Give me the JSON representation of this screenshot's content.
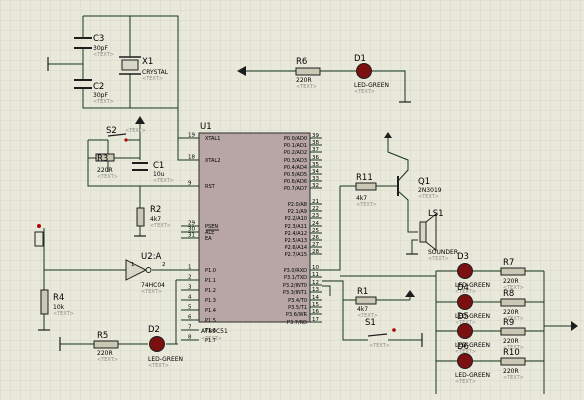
{
  "placeholder": "<TEXT>",
  "colors": {
    "background": "#e9e9db",
    "grid": "#c9c9b9",
    "wire": "#15351d",
    "ic_body": "#b8a6a6",
    "resistor": "#c8c8b4",
    "led": "#7a1010",
    "accent": "#b00000"
  },
  "u1": {
    "ref": "U1",
    "value": "AT89C51",
    "left_pins": [
      {
        "num": "19",
        "name": "XTAL1"
      },
      {
        "num": "18",
        "name": "XTAL2"
      },
      {
        "num": "9",
        "name": "RST"
      },
      {
        "num": "29",
        "name": "PSEN"
      },
      {
        "num": "30",
        "name": "ALE"
      },
      {
        "num": "31",
        "name": "EA"
      },
      {
        "num": "1",
        "name": "P1.0"
      },
      {
        "num": "2",
        "name": "P1.1"
      },
      {
        "num": "3",
        "name": "P1.2"
      },
      {
        "num": "4",
        "name": "P1.3"
      },
      {
        "num": "5",
        "name": "P1.4"
      },
      {
        "num": "6",
        "name": "P1.5"
      },
      {
        "num": "7",
        "name": "P1.6"
      },
      {
        "num": "8",
        "name": "P1.7"
      }
    ],
    "right_pins": [
      {
        "num": "39",
        "name": "P0.0/AD0"
      },
      {
        "num": "38",
        "name": "P0.1/AD1"
      },
      {
        "num": "37",
        "name": "P0.2/AD2"
      },
      {
        "num": "36",
        "name": "P0.3/AD3"
      },
      {
        "num": "35",
        "name": "P0.4/AD4"
      },
      {
        "num": "34",
        "name": "P0.5/AD5"
      },
      {
        "num": "33",
        "name": "P0.6/AD6"
      },
      {
        "num": "32",
        "name": "P0.7/AD7"
      },
      {
        "num": "21",
        "name": "P2.0/A8"
      },
      {
        "num": "22",
        "name": "P2.1/A9"
      },
      {
        "num": "23",
        "name": "P2.2/A10"
      },
      {
        "num": "24",
        "name": "P2.3/A11"
      },
      {
        "num": "25",
        "name": "P2.4/A12"
      },
      {
        "num": "26",
        "name": "P2.5/A13"
      },
      {
        "num": "27",
        "name": "P2.6/A14"
      },
      {
        "num": "28",
        "name": "P2.7/A15"
      },
      {
        "num": "10",
        "name": "P3.0/RXD"
      },
      {
        "num": "11",
        "name": "P3.1/TXD"
      },
      {
        "num": "12",
        "name": "P3.2/INT0"
      },
      {
        "num": "13",
        "name": "P3.3/INT1"
      },
      {
        "num": "14",
        "name": "P3.4/T0"
      },
      {
        "num": "15",
        "name": "P3.5/T1"
      },
      {
        "num": "16",
        "name": "P3.6/WR"
      },
      {
        "num": "17",
        "name": "P3.7/RD"
      }
    ]
  },
  "components": {
    "c3": {
      "ref": "C3",
      "value": "30pF"
    },
    "c2": {
      "ref": "C2",
      "value": "30pF"
    },
    "x1": {
      "ref": "X1",
      "value": "CRYSTAL"
    },
    "r6": {
      "ref": "R6",
      "value": "220R"
    },
    "d1": {
      "ref": "D1",
      "value": "LED-GREEN"
    },
    "s2": {
      "ref": "S2"
    },
    "r3": {
      "ref": "R3",
      "value": "220R"
    },
    "c1": {
      "ref": "C1",
      "value": "10u"
    },
    "r2": {
      "ref": "R2",
      "value": "4k7"
    },
    "r4": {
      "ref": "R4",
      "value": "10k"
    },
    "u2": {
      "ref": "U2:A",
      "value": "74HC04",
      "pin_in": "1",
      "pin_out": "2"
    },
    "r5": {
      "ref": "R5",
      "value": "220R"
    },
    "d2": {
      "ref": "D2",
      "value": "LED-GREEN"
    },
    "r11": {
      "ref": "R11",
      "value": "4k7"
    },
    "q1": {
      "ref": "Q1",
      "value": "2N3019"
    },
    "ls1": {
      "ref": "LS1",
      "value": "SOUNDER"
    },
    "r1": {
      "ref": "R1",
      "value": "4k7"
    },
    "s1": {
      "ref": "S1"
    },
    "d3": {
      "ref": "D3",
      "value": "LED-GREEN"
    },
    "d4": {
      "ref": "D4",
      "value": "LED-GREEN"
    },
    "d5": {
      "ref": "D5",
      "value": "LED-GREEN"
    },
    "d6": {
      "ref": "D6",
      "value": "LED-GREEN"
    },
    "r7": {
      "ref": "R7",
      "value": "220R"
    },
    "r8": {
      "ref": "R8",
      "value": "220R"
    },
    "r9": {
      "ref": "R9",
      "value": "220R"
    },
    "r10": {
      "ref": "R10",
      "value": "220R"
    }
  }
}
